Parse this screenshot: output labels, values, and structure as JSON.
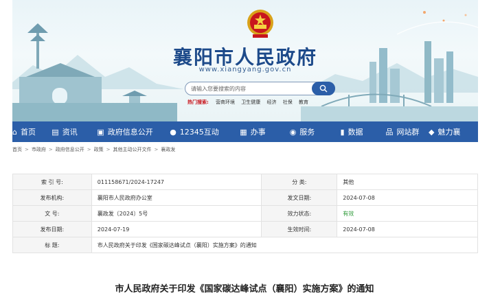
{
  "banner": {
    "title": "襄阳市人民政府",
    "url": "www.xiangyang.gov.cn",
    "emblem_icon": "national-emblem"
  },
  "search": {
    "placeholder": "请输入您要搜索的内容",
    "button_icon": "search-icon"
  },
  "hot_search": {
    "label": "热门搜索:",
    "items": [
      "营商环境",
      "卫生健康",
      "经济",
      "社保",
      "教育"
    ]
  },
  "nav": {
    "items": [
      {
        "label": "首页",
        "icon": "home-icon"
      },
      {
        "label": "资讯",
        "icon": "news-icon"
      },
      {
        "label": "政府信息公开",
        "icon": "book-icon"
      },
      {
        "label": "12345互动",
        "icon": "chat-icon"
      },
      {
        "label": "办事",
        "icon": "grid-icon"
      },
      {
        "label": "服务",
        "icon": "user-service-icon"
      },
      {
        "label": "数据",
        "icon": "bar-chart-icon"
      },
      {
        "label": "网站群",
        "icon": "sitemap-icon"
      },
      {
        "label": "魅力襄",
        "icon": "gift-icon"
      }
    ]
  },
  "breadcrumb": [
    "首页",
    "市政府",
    "政府信息公开",
    "政策",
    "其他主动公开文件",
    "襄政发"
  ],
  "info": {
    "rows": [
      {
        "l1": "索 引 号:",
        "v1": "011158671/2024-17247",
        "l2": "分      类:",
        "v2": "其他"
      },
      {
        "l1": "发布机构:",
        "v1": "襄阳市人民政府办公室",
        "l2": "发文日期:",
        "v2": "2024-07-08"
      },
      {
        "l1": "文      号:",
        "v1": "襄政发〔2024〕5号",
        "l2": "效力状态:",
        "v2": "有效"
      },
      {
        "l1": "发布日期:",
        "v1": "2024-07-19",
        "l2": "生效时间:",
        "v2": "2024-07-08"
      }
    ],
    "title_label": "标      题:",
    "title_value": "市人民政府关于印发《国家碳达峰试点（襄阳）实施方案》的通知"
  },
  "heading": "市人民政府关于印发《国家碳达峰试点（襄阳）实施方案》的通知",
  "colors": {
    "nav": "#2b5ea8",
    "title": "#1d4a8a",
    "hot_label": "#c8161d",
    "status_valid": "#2f9a3a"
  }
}
